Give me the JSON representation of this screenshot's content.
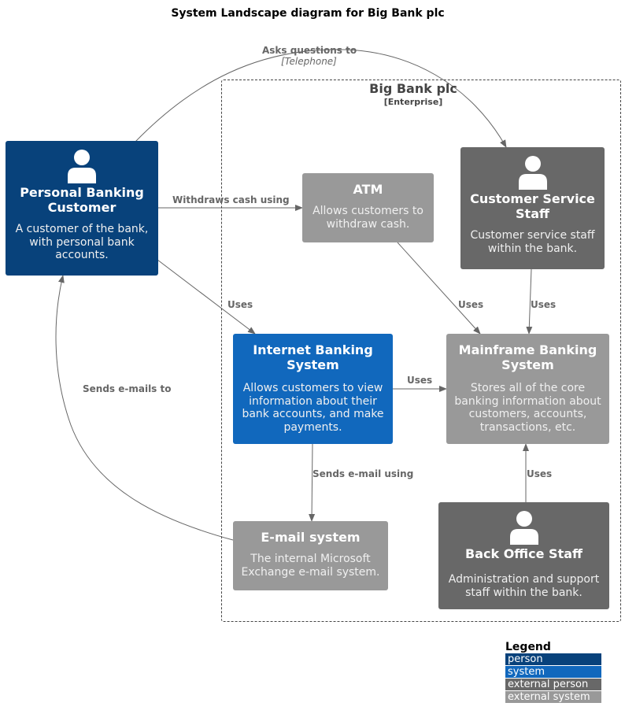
{
  "title": "System Landscape diagram for Big Bank plc",
  "colors": {
    "person": "#08427b",
    "system": "#1168bd",
    "external_person": "#686868",
    "external_system": "#999999",
    "arrow": "#666666",
    "boundary": "#444444"
  },
  "boundary": {
    "name": "Big Bank plc",
    "type": "[Enterprise]"
  },
  "nodes": {
    "customer": {
      "kind": "person",
      "icon": "person-icon",
      "name_lines": [
        "Personal Banking",
        "Customer"
      ],
      "desc_lines": [
        "A customer of the bank,",
        "with personal bank",
        "accounts."
      ]
    },
    "atm": {
      "kind": "external_system",
      "name_lines": [
        "ATM"
      ],
      "desc_lines": [
        "Allows customers to",
        "withdraw cash."
      ]
    },
    "customer_service": {
      "kind": "external_person",
      "icon": "person-icon",
      "name_lines": [
        "Customer Service",
        "Staff"
      ],
      "desc_lines": [
        "Customer service staff",
        "within the bank."
      ]
    },
    "internet_banking": {
      "kind": "system",
      "name_lines": [
        "Internet Banking",
        "System"
      ],
      "desc_lines": [
        "Allows customers to view",
        "information about their",
        "bank accounts, and make",
        "payments."
      ]
    },
    "mainframe": {
      "kind": "external_system",
      "name_lines": [
        "Mainframe Banking",
        "System"
      ],
      "desc_lines": [
        "Stores all of the core",
        "banking information about",
        "customers, accounts,",
        "transactions, etc."
      ]
    },
    "email": {
      "kind": "external_system",
      "name_lines": [
        "E-mail system"
      ],
      "desc_lines": [
        "The internal Microsoft",
        "Exchange e-mail system."
      ]
    },
    "back_office": {
      "kind": "external_person",
      "icon": "person-icon",
      "name_lines": [
        "Back Office Staff"
      ],
      "desc_lines": [
        "Administration and support",
        "staff within the bank."
      ]
    }
  },
  "relationships": [
    {
      "from": "customer",
      "to": "customer_service",
      "label": "Asks questions to",
      "technology": "[Telephone]"
    },
    {
      "from": "customer",
      "to": "atm",
      "label": "Withdraws cash using"
    },
    {
      "from": "customer",
      "to": "internet_banking",
      "label": "Uses"
    },
    {
      "from": "atm",
      "to": "mainframe",
      "label": "Uses"
    },
    {
      "from": "customer_service",
      "to": "mainframe",
      "label": "Uses"
    },
    {
      "from": "internet_banking",
      "to": "mainframe",
      "label": "Uses"
    },
    {
      "from": "internet_banking",
      "to": "email",
      "label": "Sends e-mail using"
    },
    {
      "from": "email",
      "to": "customer",
      "label": "Sends e-mails to"
    },
    {
      "from": "back_office",
      "to": "mainframe",
      "label": "Uses"
    }
  ],
  "legend": {
    "title": "Legend",
    "items": [
      {
        "label": "person",
        "color": "#08427b"
      },
      {
        "label": "system",
        "color": "#1168bd"
      },
      {
        "label": "external person",
        "color": "#686868"
      },
      {
        "label": "external system",
        "color": "#999999"
      }
    ]
  }
}
